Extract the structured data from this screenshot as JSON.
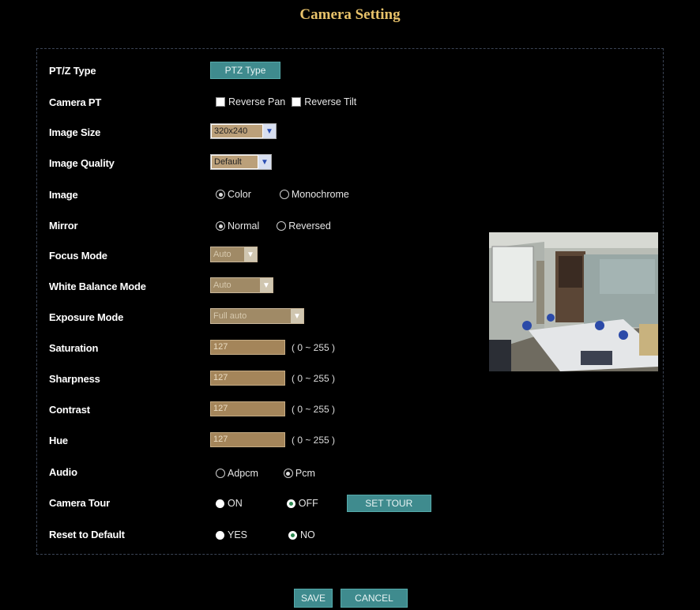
{
  "title": "Camera Setting",
  "ptz_type": {
    "label": "PT/Z Type",
    "button": "PTZ Type"
  },
  "camera_pt": {
    "label": "Camera PT",
    "reverse_pan": "Reverse Pan",
    "reverse_tilt": "Reverse Tilt"
  },
  "image_size": {
    "label": "Image Size",
    "value": "320x240"
  },
  "image_quality": {
    "label": "Image Quality",
    "value": "Default"
  },
  "image": {
    "label": "Image",
    "options": [
      "Color",
      "Monochrome"
    ],
    "selected": "Color"
  },
  "mirror": {
    "label": "Mirror",
    "options": [
      "Normal",
      "Reversed"
    ],
    "selected": "Normal"
  },
  "focus_mode": {
    "label": "Focus Mode",
    "value": "Auto"
  },
  "white_balance": {
    "label": "White Balance Mode",
    "value": "Auto"
  },
  "exposure_mode": {
    "label": "Exposure Mode",
    "value": "Full auto"
  },
  "saturation": {
    "label": "Saturation",
    "value": "127",
    "range": "( 0 ~ 255 )"
  },
  "sharpness": {
    "label": "Sharpness",
    "value": "127",
    "range": "( 0 ~ 255 )"
  },
  "contrast": {
    "label": "Contrast",
    "value": "127",
    "range": "( 0 ~ 255 )"
  },
  "hue": {
    "label": "Hue",
    "value": "127",
    "range": "( 0 ~ 255 )"
  },
  "audio": {
    "label": "Audio",
    "options": [
      "Adpcm",
      "Pcm"
    ],
    "selected": "Pcm"
  },
  "camera_tour": {
    "label": "Camera Tour",
    "on": "ON",
    "off": "OFF",
    "selected": "OFF",
    "button": "SET TOUR"
  },
  "reset": {
    "label": "Reset to Default",
    "yes": "YES",
    "no": "NO",
    "selected": "NO"
  },
  "footer": {
    "save": "SAVE",
    "cancel": "CANCEL"
  }
}
